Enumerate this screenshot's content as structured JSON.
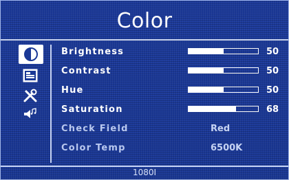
{
  "title": "Color",
  "sidebar": {
    "icons": [
      {
        "name": "color-icon",
        "active": true
      },
      {
        "name": "display-icon",
        "active": false
      },
      {
        "name": "tools-icon",
        "active": false
      },
      {
        "name": "audio-icon",
        "active": false
      }
    ]
  },
  "menu": {
    "brightness": {
      "label": "Brightness",
      "value": "50",
      "level": 0.5
    },
    "contrast": {
      "label": "Contrast",
      "value": "50",
      "level": 0.5
    },
    "hue": {
      "label": "Hue",
      "value": "50",
      "level": 0.5
    },
    "saturation": {
      "label": "Saturation",
      "value": "68",
      "level": 0.68
    },
    "check_field": {
      "label": "Check Field",
      "value": "Red"
    },
    "color_temp": {
      "label": "Color Temp",
      "value": "6500K"
    }
  },
  "status": "1080I",
  "colors": {
    "background": "#1a3896",
    "text": "#ffffff",
    "accent": "#c9d5f4"
  }
}
